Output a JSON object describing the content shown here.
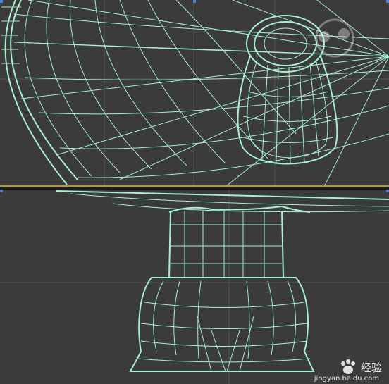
{
  "viewports": {
    "top": {
      "label": ""
    },
    "bottom": {
      "label": ""
    }
  },
  "colors": {
    "wireframe": "#a8f0cf",
    "background": "#3b3b3b",
    "active_border": "#b79a2c",
    "corner_marker": "#4b7fd6"
  },
  "watermark": {
    "brand": "经验",
    "url": "jingyan.baidu.com",
    "icon": "baidu-paw-icon"
  }
}
